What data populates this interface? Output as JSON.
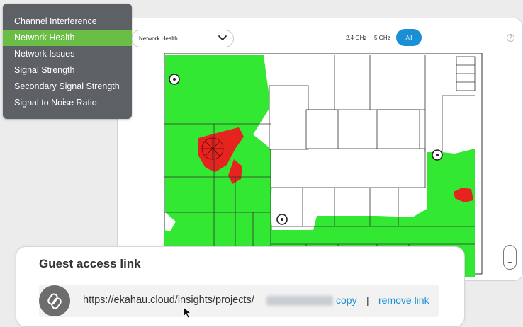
{
  "header": {
    "view_select": "Network Health",
    "bands": [
      "2.4 GHz",
      "5 GHz",
      "All"
    ],
    "active_band": "All",
    "help": "?"
  },
  "menu": {
    "items": [
      {
        "label": "Channel Interference"
      },
      {
        "label": "Network Health"
      },
      {
        "label": "Network Issues"
      },
      {
        "label": "Signal Strength"
      },
      {
        "label": "Secondary Signal Strength"
      },
      {
        "label": "Signal to Noise Ratio"
      }
    ],
    "selected": "Network Health"
  },
  "zoom": {
    "in": "+",
    "out": "−"
  },
  "guest_access": {
    "title": "Guest access link",
    "url_prefix": "https://ekahau.cloud/insights/projects/",
    "copy_label": "copy",
    "separator": "|",
    "remove_label": "remove link"
  },
  "colors": {
    "healthy": "#33e833",
    "issue": "#e5231f",
    "accent": "#1b8fd6",
    "menu_bg": "#5d6166",
    "menu_active": "#6abd45"
  },
  "icons": [
    "chevron-down-icon",
    "help-icon",
    "link-icon",
    "access-point-icon",
    "cursor-icon"
  ]
}
